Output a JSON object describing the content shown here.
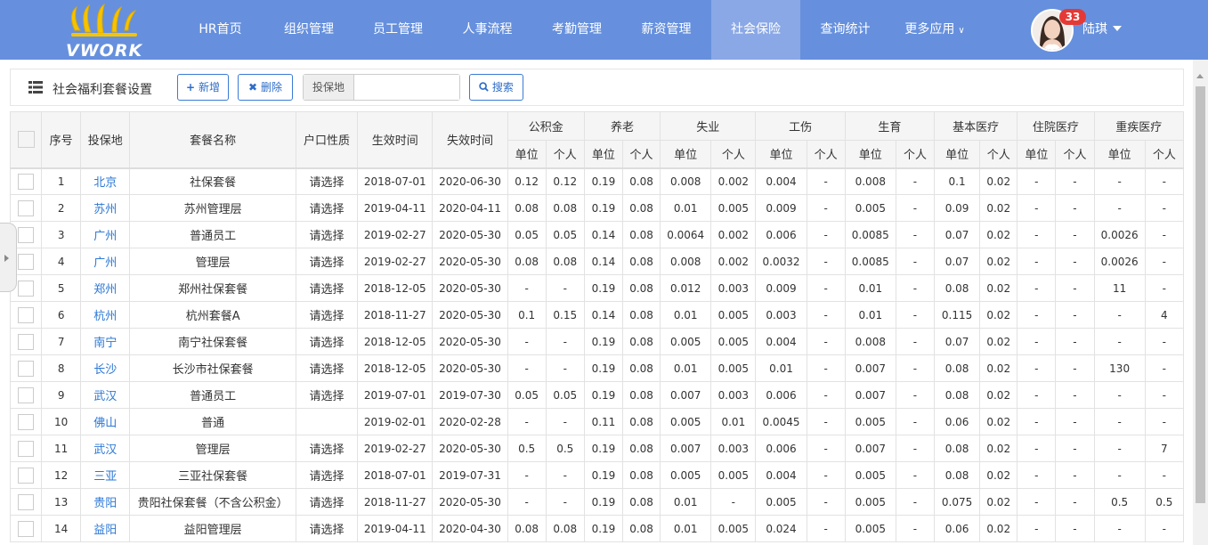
{
  "app": {
    "logo_text": "VWORK",
    "nav": [
      {
        "label": "HR首页"
      },
      {
        "label": "组织管理"
      },
      {
        "label": "员工管理"
      },
      {
        "label": "人事流程"
      },
      {
        "label": "考勤管理"
      },
      {
        "label": "薪资管理"
      },
      {
        "label": "社会保险"
      },
      {
        "label": "查询统计"
      },
      {
        "label": "更多应用"
      }
    ],
    "active_nav": "社会保险",
    "user": {
      "name": "陆琪",
      "notifications": "33"
    }
  },
  "toolbar": {
    "title": "社会福利套餐设置",
    "add_label": "新增",
    "delete_label": "删除",
    "filter_label": "投保地",
    "filter_value": "",
    "search_label": "搜索"
  },
  "table": {
    "columns": {
      "seq": "序号",
      "location": "投保地",
      "name": "套餐名称",
      "hukou": "户口性质",
      "start": "生效时间",
      "end": "失效时间"
    },
    "groups": [
      "公积金",
      "养老",
      "失业",
      "工伤",
      "生育",
      "基本医疗",
      "住院医疗",
      "重疾医疗"
    ],
    "sub": {
      "unit": "单位",
      "personal": "个人"
    },
    "rows": [
      {
        "seq": "1",
        "city": "北京",
        "name": "社保套餐",
        "hukou": "请选择",
        "start": "2018-07-01",
        "end": "2020-06-30",
        "v": [
          "0.12",
          "0.12",
          "0.19",
          "0.08",
          "0.008",
          "0.002",
          "0.004",
          "-",
          "0.008",
          "-",
          "0.1",
          "0.02",
          "-",
          "-",
          "-",
          "-"
        ]
      },
      {
        "seq": "2",
        "city": "苏州",
        "name": "苏州管理层",
        "hukou": "请选择",
        "start": "2019-04-11",
        "end": "2020-04-11",
        "v": [
          "0.08",
          "0.08",
          "0.19",
          "0.08",
          "0.01",
          "0.005",
          "0.009",
          "-",
          "0.005",
          "-",
          "0.09",
          "0.02",
          "-",
          "-",
          "-",
          "-"
        ]
      },
      {
        "seq": "3",
        "city": "广州",
        "name": "普通员工",
        "hukou": "请选择",
        "start": "2019-02-27",
        "end": "2020-05-30",
        "v": [
          "0.05",
          "0.05",
          "0.14",
          "0.08",
          "0.0064",
          "0.002",
          "0.006",
          "-",
          "0.0085",
          "-",
          "0.07",
          "0.02",
          "-",
          "-",
          "0.0026",
          "-"
        ]
      },
      {
        "seq": "4",
        "city": "广州",
        "name": "管理层",
        "hukou": "请选择",
        "start": "2019-02-27",
        "end": "2020-05-30",
        "v": [
          "0.08",
          "0.08",
          "0.14",
          "0.08",
          "0.008",
          "0.002",
          "0.0032",
          "-",
          "0.0085",
          "-",
          "0.07",
          "0.02",
          "-",
          "-",
          "0.0026",
          "-"
        ]
      },
      {
        "seq": "5",
        "city": "郑州",
        "name": "郑州社保套餐",
        "hukou": "请选择",
        "start": "2018-12-05",
        "end": "2020-05-30",
        "v": [
          "-",
          "-",
          "0.19",
          "0.08",
          "0.012",
          "0.003",
          "0.009",
          "-",
          "0.01",
          "-",
          "0.08",
          "0.02",
          "-",
          "-",
          "11",
          "-"
        ]
      },
      {
        "seq": "6",
        "city": "杭州",
        "name": "杭州套餐A",
        "hukou": "请选择",
        "start": "2018-11-27",
        "end": "2020-05-30",
        "v": [
          "0.1",
          "0.15",
          "0.14",
          "0.08",
          "0.01",
          "0.005",
          "0.003",
          "-",
          "0.01",
          "-",
          "0.115",
          "0.02",
          "-",
          "-",
          "-",
          "4"
        ]
      },
      {
        "seq": "7",
        "city": "南宁",
        "name": "南宁社保套餐",
        "hukou": "请选择",
        "start": "2018-12-05",
        "end": "2020-05-30",
        "v": [
          "-",
          "-",
          "0.19",
          "0.08",
          "0.005",
          "0.005",
          "0.004",
          "-",
          "0.008",
          "-",
          "0.07",
          "0.02",
          "-",
          "-",
          "-",
          "-"
        ]
      },
      {
        "seq": "8",
        "city": "长沙",
        "name": "长沙市社保套餐",
        "hukou": "请选择",
        "start": "2018-12-05",
        "end": "2020-05-30",
        "v": [
          "-",
          "-",
          "0.19",
          "0.08",
          "0.01",
          "0.005",
          "0.01",
          "-",
          "0.007",
          "-",
          "0.08",
          "0.02",
          "-",
          "-",
          "130",
          "-"
        ]
      },
      {
        "seq": "9",
        "city": "武汉",
        "name": "普通员工",
        "hukou": "请选择",
        "start": "2019-07-01",
        "end": "2019-07-30",
        "v": [
          "0.05",
          "0.05",
          "0.19",
          "0.08",
          "0.007",
          "0.003",
          "0.006",
          "-",
          "0.007",
          "-",
          "0.08",
          "0.02",
          "-",
          "-",
          "-",
          "-"
        ]
      },
      {
        "seq": "10",
        "city": "佛山",
        "name": "普通",
        "hukou": "",
        "start": "2019-02-01",
        "end": "2020-02-28",
        "v": [
          "-",
          "-",
          "0.11",
          "0.08",
          "0.005",
          "0.01",
          "0.0045",
          "-",
          "0.005",
          "-",
          "0.06",
          "0.02",
          "-",
          "-",
          "-",
          "-"
        ]
      },
      {
        "seq": "11",
        "city": "武汉",
        "name": "管理层",
        "hukou": "请选择",
        "start": "2019-02-27",
        "end": "2020-05-30",
        "v": [
          "0.5",
          "0.5",
          "0.19",
          "0.08",
          "0.007",
          "0.003",
          "0.006",
          "-",
          "0.007",
          "-",
          "0.08",
          "0.02",
          "-",
          "-",
          "-",
          "7"
        ]
      },
      {
        "seq": "12",
        "city": "三亚",
        "name": "三亚社保套餐",
        "hukou": "请选择",
        "start": "2018-07-01",
        "end": "2019-07-31",
        "v": [
          "-",
          "-",
          "0.19",
          "0.08",
          "0.005",
          "0.005",
          "0.004",
          "-",
          "0.005",
          "-",
          "0.08",
          "0.02",
          "-",
          "-",
          "-",
          "-"
        ]
      },
      {
        "seq": "13",
        "city": "贵阳",
        "name": "贵阳社保套餐（不含公积金）",
        "hukou": "请选择",
        "start": "2018-11-27",
        "end": "2020-05-30",
        "v": [
          "-",
          "-",
          "0.19",
          "0.08",
          "0.01",
          "-",
          "0.005",
          "-",
          "0.005",
          "-",
          "0.075",
          "0.02",
          "-",
          "-",
          "0.5",
          "0.5"
        ]
      },
      {
        "seq": "14",
        "city": "益阳",
        "name": "益阳管理层",
        "hukou": "请选择",
        "start": "2019-04-11",
        "end": "2020-04-30",
        "v": [
          "0.08",
          "0.08",
          "0.19",
          "0.08",
          "0.01",
          "0.005",
          "0.024",
          "-",
          "0.005",
          "-",
          "0.06",
          "0.02",
          "-",
          "-",
          "-",
          "-"
        ]
      }
    ]
  }
}
